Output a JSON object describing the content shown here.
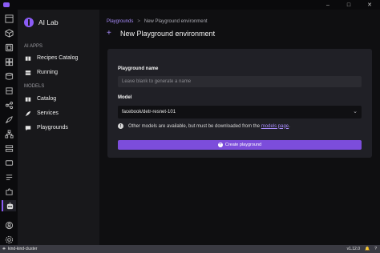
{
  "window": {
    "controls": [
      "–",
      "□",
      "✕"
    ]
  },
  "iconbar": {
    "items": [
      "dashboard-icon",
      "containers-icon",
      "pods-icon",
      "images-icon",
      "volumes-icon",
      "extensions-icon",
      "share-icon",
      "rocket-icon",
      "network-icon",
      "storage-icon",
      "deploy-icon",
      "kubernetes-icon",
      "puzzle-icon",
      "ai-lab-icon",
      "account-icon",
      "settings-icon"
    ]
  },
  "sidebar": {
    "brand": "AI Lab",
    "sections": [
      {
        "label": "AI APPS",
        "items": [
          {
            "label": "Recipes Catalog",
            "icon": "book-icon"
          },
          {
            "label": "Running",
            "icon": "server-icon"
          }
        ]
      },
      {
        "label": "MODELS",
        "items": [
          {
            "label": "Catalog",
            "icon": "book-icon"
          },
          {
            "label": "Services",
            "icon": "rocket-icon"
          },
          {
            "label": "Playgrounds",
            "icon": "chat-icon"
          }
        ]
      }
    ]
  },
  "main": {
    "breadcrumb": {
      "link": "Playgrounds",
      "separator": ">",
      "current": "New Playground environment"
    },
    "title": "New Playground environment",
    "form": {
      "name_label": "Playground name",
      "name_placeholder": "Leave blank to generate a name",
      "model_label": "Model",
      "model_value": "facebook/detr-resnet-101",
      "info_text": "Other models are available, but must be downloaded from the",
      "info_link": "models page",
      "info_suffix": ".",
      "submit_label": "Create playground"
    }
  },
  "statusbar": {
    "cluster": "kind-kind-cluster",
    "version": "v1.12.0"
  },
  "colors": {
    "accent": "#8b5cf6",
    "button": "#7c4ddb",
    "link": "#a78bfa"
  }
}
